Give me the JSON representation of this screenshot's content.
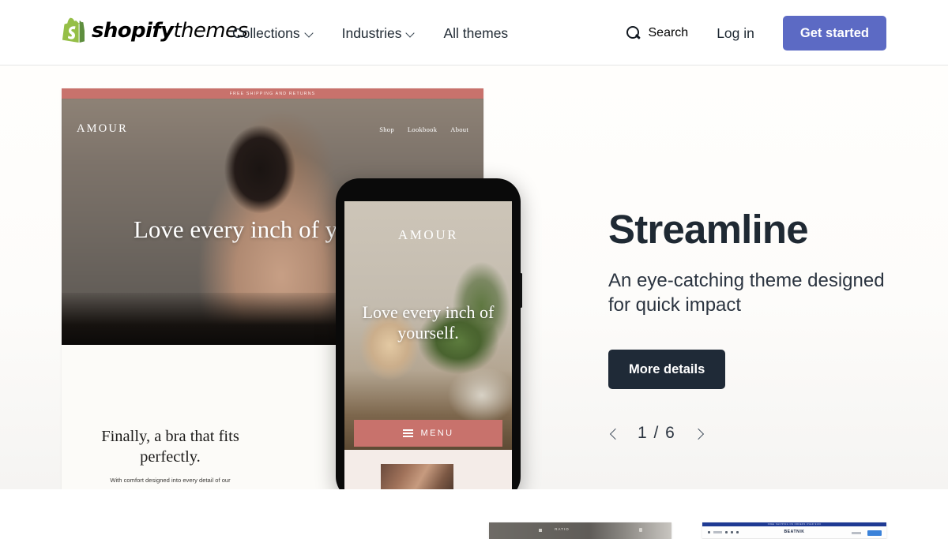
{
  "header": {
    "logo": {
      "icon": "shopify-bag-icon",
      "brand_bold": "shopify",
      "brand_light": "themes"
    },
    "nav": [
      {
        "label": "Collections",
        "has_dropdown": true,
        "icon": "chevron-down-icon"
      },
      {
        "label": "Industries",
        "has_dropdown": true,
        "icon": "chevron-down-icon"
      },
      {
        "label": "All themes",
        "has_dropdown": false
      }
    ],
    "search": {
      "label": "Search",
      "icon": "search-icon"
    },
    "login_label": "Log in",
    "cta_label": "Get started",
    "cta_color": "#5c6ac4"
  },
  "hero": {
    "title": "Streamline",
    "subtitle": "An eye-catching theme designed for quick impact",
    "details_label": "More details",
    "details_color": "#1f2a37",
    "carousel": {
      "prev_icon": "chevron-left-icon",
      "next_icon": "chevron-right-icon",
      "current": "1",
      "separator": "/",
      "total": "6",
      "counter": "1 / 6"
    }
  },
  "preview_desktop": {
    "announcement": "FREE SHIPPING AND RETURNS",
    "announcement_color": "#c8726c",
    "brand": "AMOUR",
    "nav": [
      "Shop",
      "Lookbook",
      "About"
    ],
    "headline": "Love every inch of yourself.",
    "section_headline": "Finally, a bra that fits perfectly.",
    "section_body": "With comfort designed into every detail of our"
  },
  "preview_mobile": {
    "brand": "AMOUR",
    "headline": "Love every inch of yourself.",
    "menu_label": "MENU",
    "menu_icon": "hamburger-icon",
    "menu_color": "#c8726c"
  },
  "thumbnails": [
    {
      "name": "RATIO",
      "accent": "#6e6b66"
    },
    {
      "name": "BEATNIK",
      "accent": "#1f3a93",
      "bar_text": "FREE SHIPPING ON ORDERS OVER $100"
    }
  ]
}
